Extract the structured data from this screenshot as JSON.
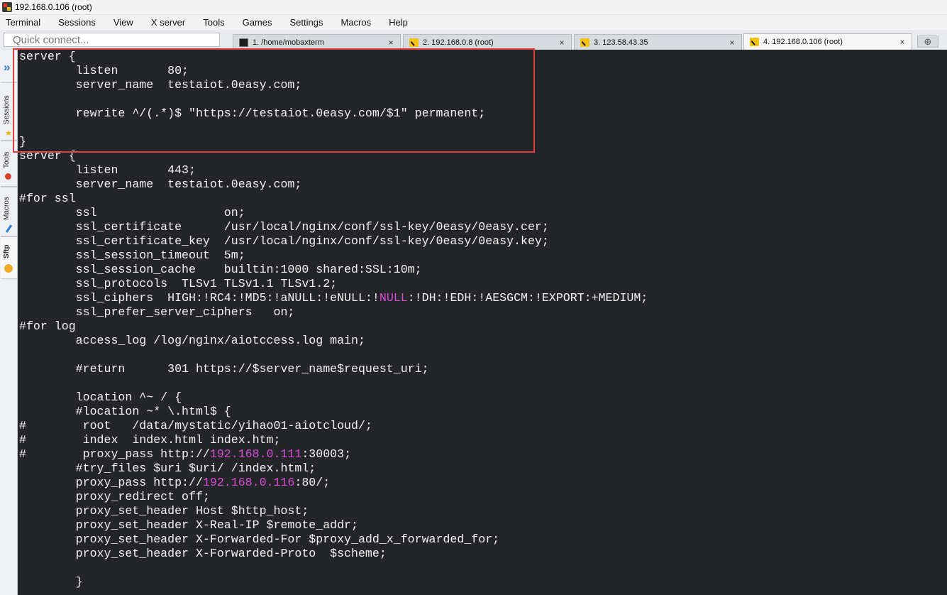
{
  "window": {
    "title": "192.168.0.106 (root)"
  },
  "menu": {
    "items": [
      "Terminal",
      "Sessions",
      "View",
      "X server",
      "Tools",
      "Games",
      "Settings",
      "Macros",
      "Help"
    ]
  },
  "quick_connect": {
    "placeholder": "Quick connect..."
  },
  "tabs": [
    {
      "label": "1. /home/mobaxterm",
      "icon": "terminal-icon",
      "active": false
    },
    {
      "label": "2. 192.168.0.8 (root)",
      "icon": "ssh-icon",
      "active": false
    },
    {
      "label": "3. 123.58.43.35",
      "icon": "ssh-icon",
      "active": false
    },
    {
      "label": "4. 192.168.0.106 (root)",
      "icon": "ssh-icon",
      "active": true
    }
  ],
  "tab_close_glyph": "×",
  "new_tab_glyph": "⊕",
  "sidebar": {
    "collapse_glyph": "»",
    "tabs": [
      {
        "label": "Sessions",
        "icon": "star-icon"
      },
      {
        "label": "Tools",
        "icon": "tools-icon"
      },
      {
        "label": "Macros",
        "icon": "pen-icon"
      },
      {
        "label": "Sftp",
        "icon": "globe-icon"
      }
    ]
  },
  "colors": {
    "terminal_bg": "#232528",
    "terminal_fg": "#f2f2f2",
    "terminal_highlight": "#d64bd6",
    "annotation_box": "#e43d3d"
  },
  "terminal": {
    "lines": [
      [
        {
          "t": "server {"
        }
      ],
      [
        {
          "t": "        listen       80;"
        }
      ],
      [
        {
          "t": "        server_name  testaiot.0easy.com;"
        }
      ],
      [
        {
          "t": ""
        }
      ],
      [
        {
          "t": "        rewrite ^/(.*)$ \"https://testaiot.0easy.com/$1\" permanent;"
        }
      ],
      [
        {
          "t": ""
        }
      ],
      [
        {
          "t": "}"
        }
      ],
      [
        {
          "t": "server {"
        }
      ],
      [
        {
          "t": "        listen       443;"
        }
      ],
      [
        {
          "t": "        server_name  testaiot.0easy.com;"
        }
      ],
      [
        {
          "t": "#for ssl"
        }
      ],
      [
        {
          "t": "        ssl                  on;"
        }
      ],
      [
        {
          "t": "        ssl_certificate      /usr/local/nginx/conf/ssl-key/0easy/0easy.cer;"
        }
      ],
      [
        {
          "t": "        ssl_certificate_key  /usr/local/nginx/conf/ssl-key/0easy/0easy.key;"
        }
      ],
      [
        {
          "t": "        ssl_session_timeout  5m;"
        }
      ],
      [
        {
          "t": "        ssl_session_cache    builtin:1000 shared:SSL:10m;"
        }
      ],
      [
        {
          "t": "        ssl_protocols  TLSv1 TLSv1.1 TLSv1.2;"
        }
      ],
      [
        {
          "t": "        ssl_ciphers  HIGH:!RC4:!MD5:!aNULL:!eNULL:!"
        },
        {
          "t": "NULL",
          "hl": true
        },
        {
          "t": ":!DH:!EDH:!AESGCM:!EXPORT:+MEDIUM;"
        }
      ],
      [
        {
          "t": "        ssl_prefer_server_ciphers   on;"
        }
      ],
      [
        {
          "t": "#for log"
        }
      ],
      [
        {
          "t": "        access_log /log/nginx/aiotccess.log main;"
        }
      ],
      [
        {
          "t": ""
        }
      ],
      [
        {
          "t": "        #return      301 https://$server_name$request_uri;"
        }
      ],
      [
        {
          "t": ""
        }
      ],
      [
        {
          "t": "        location ^~ / {"
        }
      ],
      [
        {
          "t": "        #location ~* \\.html$ {"
        }
      ],
      [
        {
          "t": "#        root   /data/mystatic/yihao01-aiotcloud/;"
        }
      ],
      [
        {
          "t": "#        index  index.html index.htm;"
        }
      ],
      [
        {
          "t": "#        proxy_pass http://"
        },
        {
          "t": "192.168.0.111",
          "hl": true
        },
        {
          "t": ":30003;"
        }
      ],
      [
        {
          "t": "        #try_files $uri $uri/ /index.html;"
        }
      ],
      [
        {
          "t": "        proxy_pass http://"
        },
        {
          "t": "192.168.0.116",
          "hl": true
        },
        {
          "t": ":80/;"
        }
      ],
      [
        {
          "t": "        proxy_redirect off;"
        }
      ],
      [
        {
          "t": "        proxy_set_header Host $http_host;"
        }
      ],
      [
        {
          "t": "        proxy_set_header X-Real-IP $remote_addr;"
        }
      ],
      [
        {
          "t": "        proxy_set_header X-Forwarded-For $proxy_add_x_forwarded_for;"
        }
      ],
      [
        {
          "t": "        proxy_set_header X-Forwarded-Proto  $scheme;"
        }
      ],
      [
        {
          "t": ""
        }
      ],
      [
        {
          "t": "        }"
        }
      ]
    ]
  }
}
